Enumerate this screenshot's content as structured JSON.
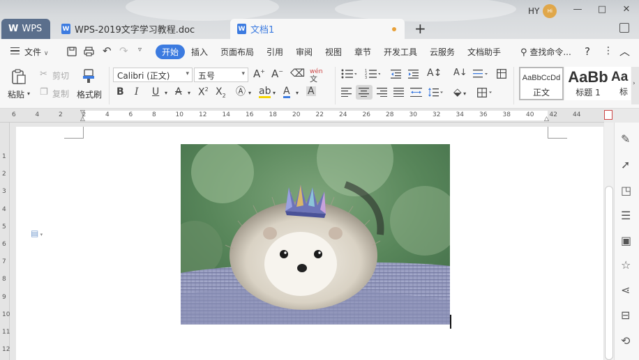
{
  "window": {
    "user_initials": "HY",
    "avatar_text": "Hi",
    "minimize": "—",
    "restore": "□",
    "close": "✕"
  },
  "tabs": [
    {
      "label": "WPS",
      "icon": "wps-logo-icon"
    },
    {
      "label": "WPS-2019文字学习教程.doc",
      "icon": "word-doc-icon"
    },
    {
      "label": "文档1",
      "icon": "word-doc-icon",
      "active": true,
      "unsaved": true
    }
  ],
  "menubar": {
    "file": "文件",
    "items": [
      "开始",
      "插入",
      "页面布局",
      "引用",
      "审阅",
      "视图",
      "章节",
      "开发工具",
      "云服务",
      "文档助手"
    ],
    "active": "开始",
    "search": "查找命令...",
    "help": "?",
    "more": "⋮"
  },
  "ribbon": {
    "paste": "粘贴",
    "cut": "剪切",
    "copy": "复制",
    "format_painter": "格式刷",
    "font_name": "Calibri (正文)",
    "font_size": "五号",
    "styles": [
      {
        "preview": "AaBbCcDd",
        "name": "正文"
      },
      {
        "preview": "AaBb",
        "name": "标题 1"
      },
      {
        "preview": "Aa",
        "name": "标"
      }
    ]
  },
  "ruler": {
    "h_ticks": [
      "6",
      "4",
      "2",
      "2",
      "4",
      "6",
      "8",
      "10",
      "12",
      "14",
      "16",
      "18",
      "20",
      "22",
      "24",
      "26",
      "28",
      "30",
      "32",
      "34",
      "36",
      "38",
      "40",
      "42",
      "44"
    ],
    "v_ticks": [
      "1",
      "2",
      "3",
      "4",
      "5",
      "6",
      "7",
      "8",
      "9",
      "10",
      "11",
      "12"
    ]
  },
  "document": {
    "image_subject": "hedgehog-with-crown"
  },
  "colors": {
    "accent": "#3c7be0",
    "tab_wps": "#5b6f8c",
    "unsaved_dot": "#e8a13a"
  }
}
